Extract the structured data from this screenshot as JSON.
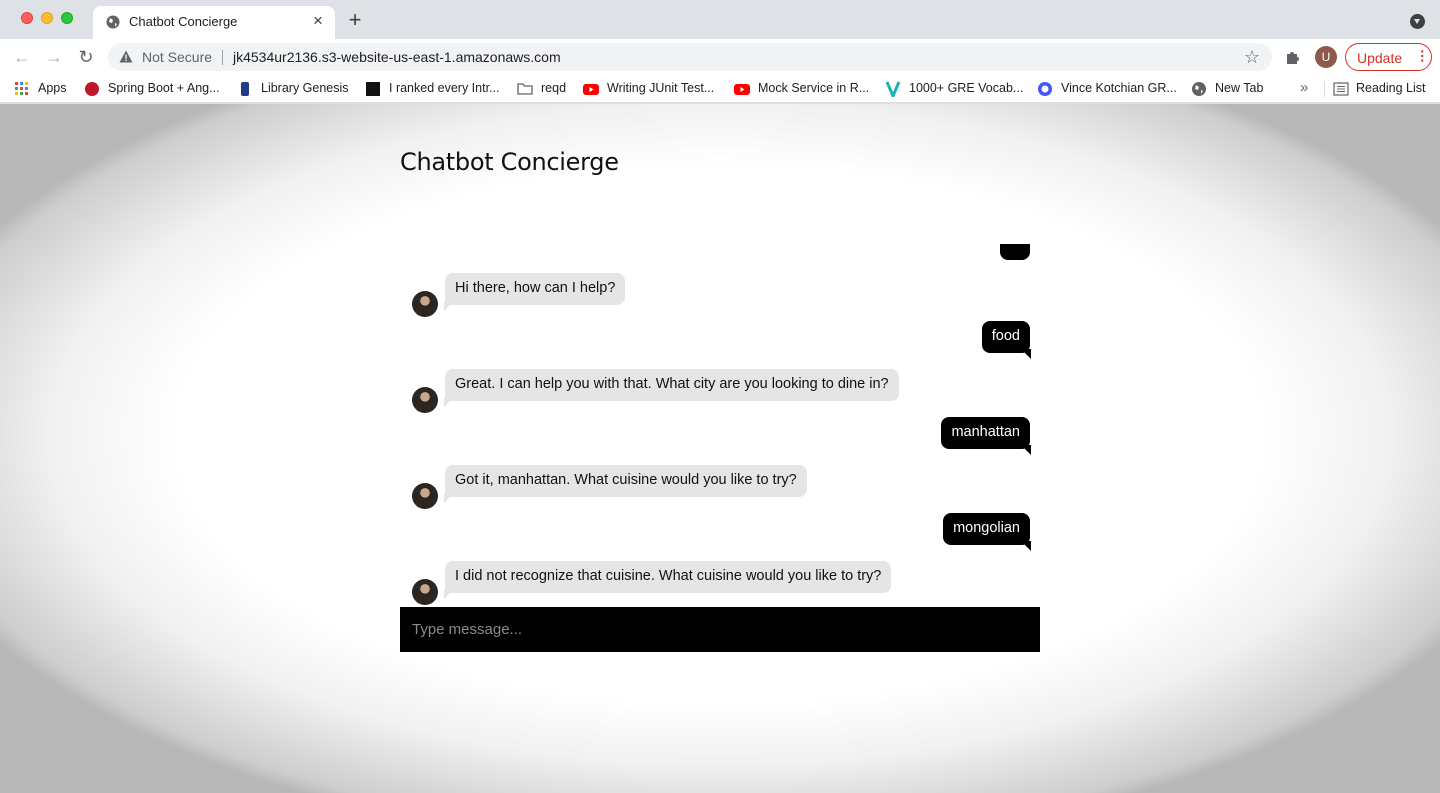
{
  "browser": {
    "tab_title": "Chatbot Concierge",
    "tab_close": "×",
    "new_tab": "+",
    "not_secure": "Not Secure",
    "url": "jk4534ur2136.s3-website-us-east-1.amazonaws.com",
    "profile_initial": "U",
    "update_label": "Update",
    "update_menu": "⋮"
  },
  "bookmarks": {
    "items": [
      {
        "label": "Apps",
        "icon": "apps-grid-icon"
      },
      {
        "label": "Spring Boot + Ang...",
        "icon": "site-favicon"
      },
      {
        "label": "Library Genesis",
        "icon": "library-icon"
      },
      {
        "label": "I ranked every Intr...",
        "icon": "site-favicon"
      },
      {
        "label": "reqd",
        "icon": "folder-icon"
      },
      {
        "label": "Writing JUnit Test...",
        "icon": "youtube-icon"
      },
      {
        "label": "Mock Service in R...",
        "icon": "youtube-icon"
      },
      {
        "label": "1000+ GRE Vocab...",
        "icon": "vocab-icon"
      },
      {
        "label": "Vince Kotchian GR...",
        "icon": "quizlet-icon"
      },
      {
        "label": "New Tab",
        "icon": "globe-icon"
      }
    ],
    "more": "»",
    "reading_list": "Reading List"
  },
  "page": {
    "title": "Chatbot Concierge",
    "input_placeholder": "Type message..."
  },
  "messages": [
    {
      "sender": "bot",
      "text": "Hi there, how can I help?"
    },
    {
      "sender": "user",
      "text": "food"
    },
    {
      "sender": "bot",
      "text": "Great. I can help you with that. What city are you looking to dine in?"
    },
    {
      "sender": "user",
      "text": "manhattan"
    },
    {
      "sender": "bot",
      "text": "Got it, manhattan. What cuisine would you like to try?"
    },
    {
      "sender": "user",
      "text": "mongolian"
    },
    {
      "sender": "bot",
      "text": "I did not recognize that cuisine. What cuisine would you like to try?"
    }
  ],
  "colors": {
    "user_bubble": "#000000",
    "bot_bubble": "#e5e5e5",
    "update_red": "#d93025"
  }
}
